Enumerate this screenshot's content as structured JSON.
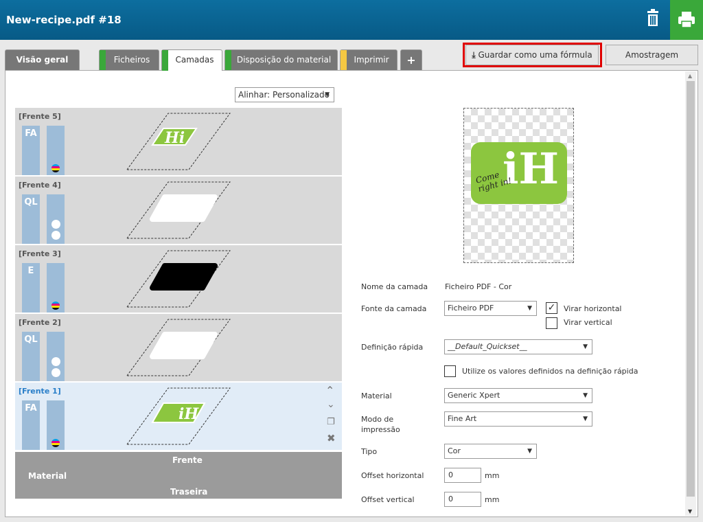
{
  "header": {
    "title": "New-recipe.pdf #18",
    "delete_icon": "trash-icon",
    "print_icon": "printer-icon"
  },
  "tabs": [
    {
      "label": "Visão geral"
    },
    {
      "label": "Ficheiros"
    },
    {
      "label": "Camadas"
    },
    {
      "label": "Disposição do material"
    },
    {
      "label": "Imprimir"
    },
    {
      "label": "+"
    }
  ],
  "actions": {
    "save_formula": "Guardar como uma fórmula",
    "sampling": "Amostragem"
  },
  "align": {
    "value": "Alinhar: Personalizado"
  },
  "layers": [
    {
      "name": "[Frente 5]",
      "code": "FA"
    },
    {
      "name": "[Frente 4]",
      "code": "QL"
    },
    {
      "name": "[Frente 3]",
      "code": "E"
    },
    {
      "name": "[Frente 2]",
      "code": "QL"
    },
    {
      "name": "[Frente 1]",
      "code": "FA"
    }
  ],
  "thumbs": {
    "hi": "Hi",
    "ih": "iH",
    "script": "Come right in!"
  },
  "material_footer": {
    "front": "Frente",
    "material": "Material",
    "back": "Traseira"
  },
  "props": {
    "layer_name_label": "Nome da camada",
    "layer_name_value": "Ficheiro PDF - Cor",
    "layer_source_label": "Fonte da camada",
    "layer_source_value": "Ficheiro PDF",
    "flip_h_label": "Virar horizontal",
    "flip_h_checked": true,
    "flip_v_label": "Virar vertical",
    "flip_v_checked": false,
    "quickset_label": "Definição rápida",
    "quickset_value": "__Default_Quickset__",
    "use_quickset_label": "Utilize os valores definidos na definição rápida",
    "material_label": "Material",
    "material_value": "Generic Xpert",
    "print_mode_label_1": "Modo de",
    "print_mode_label_2": "impressão",
    "print_mode_value": "Fine Art",
    "type_label": "Tipo",
    "type_value": "Cor",
    "offset_h_label": "Offset horizontal",
    "offset_h_value": "0",
    "offset_v_label": "Offset vertical",
    "offset_v_value": "0",
    "unit": "mm"
  },
  "colors": {
    "header": "#0b6898",
    "green": "#3aa83a",
    "yellow": "#f5c842",
    "highlight": "#e00000",
    "logo_green": "#8cc63f"
  }
}
